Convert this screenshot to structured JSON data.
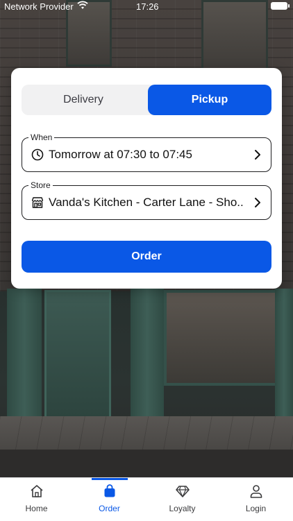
{
  "status_bar": {
    "carrier": "Network Provider",
    "time": "17:26"
  },
  "mode_toggle": {
    "options": [
      "Delivery",
      "Pickup"
    ],
    "selected": "Pickup"
  },
  "when": {
    "legend": "When",
    "value": "Tomorrow at 07:30 to 07:45",
    "icon": "clock-icon"
  },
  "store": {
    "legend": "Store",
    "value": "Vanda's Kitchen - Carter Lane - Sho...",
    "icon": "storefront-icon"
  },
  "order_button": {
    "label": "Order"
  },
  "tabs": [
    {
      "label": "Home",
      "icon": "home-icon",
      "active": false
    },
    {
      "label": "Order",
      "icon": "shopping-bag-icon",
      "active": true
    },
    {
      "label": "Loyalty",
      "icon": "diamond-icon",
      "active": false
    },
    {
      "label": "Login",
      "icon": "person-icon",
      "active": false
    }
  ],
  "colors": {
    "accent": "#0a58e6",
    "segment_bg": "#f1f1f2"
  }
}
